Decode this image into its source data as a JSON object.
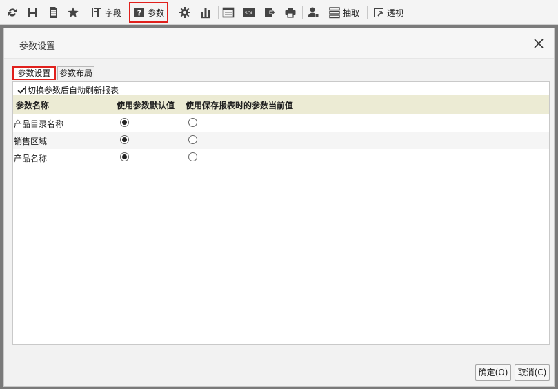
{
  "toolbar": {
    "field_label": "字段",
    "param_label": "参数",
    "extract_label": "抽取",
    "pivot_label": "透视"
  },
  "dialog": {
    "title": "参数设置",
    "tabs": [
      {
        "label": "参数设置",
        "active": true
      },
      {
        "label": "参数布局",
        "active": false
      }
    ],
    "auto_refresh_label": "切换参数后自动刷新报表",
    "auto_refresh_checked": true,
    "columns": [
      "参数名称",
      "使用参数默认值",
      "使用保存报表时的参数当前值"
    ],
    "rows": [
      {
        "name": "产品目录名称",
        "selected": "default"
      },
      {
        "name": "销售区域",
        "selected": "default"
      },
      {
        "name": "产品名称",
        "selected": "default"
      }
    ],
    "ok_label": "确定(O)",
    "cancel_label": "取消(C)"
  },
  "colors": {
    "highlight_border": "#e0201c",
    "header_row_bg": "#ecebd4"
  }
}
